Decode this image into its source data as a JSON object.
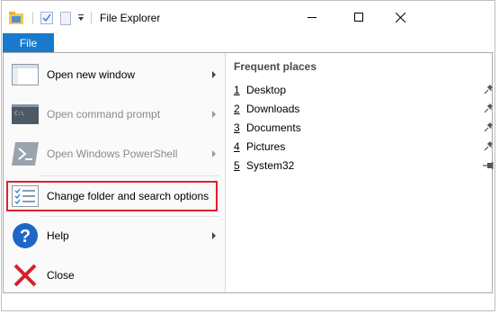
{
  "window": {
    "title": "File Explorer"
  },
  "ribbon": {
    "file_tab": "File"
  },
  "file_menu": {
    "items": [
      {
        "label": "Open new window",
        "enabled": true,
        "has_submenu": true
      },
      {
        "label": "Open command prompt",
        "enabled": false,
        "has_submenu": true
      },
      {
        "label": "Open Windows PowerShell",
        "enabled": false,
        "has_submenu": true
      },
      {
        "label": "Change folder and search options",
        "enabled": true,
        "has_submenu": false,
        "highlighted": true
      },
      {
        "label": "Help",
        "enabled": true,
        "has_submenu": true
      },
      {
        "label": "Close",
        "enabled": true,
        "has_submenu": false
      }
    ],
    "frequent_places": {
      "title": "Frequent places",
      "items": [
        {
          "num": "1",
          "name": "Desktop",
          "pinned": true
        },
        {
          "num": "2",
          "name": "Downloads",
          "pinned": true
        },
        {
          "num": "3",
          "name": "Documents",
          "pinned": true
        },
        {
          "num": "4",
          "name": "Pictures",
          "pinned": true
        },
        {
          "num": "5",
          "name": "System32",
          "pinned": false
        }
      ]
    }
  },
  "colors": {
    "accent": "#1979ca",
    "highlight_border": "#d9232d"
  }
}
